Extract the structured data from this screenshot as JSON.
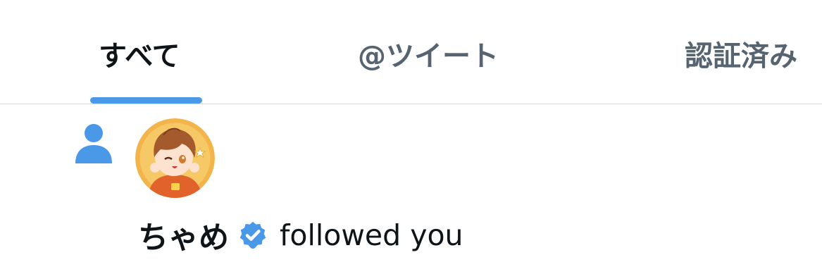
{
  "tabs": [
    {
      "label": "すべて",
      "selected": true
    },
    {
      "label": "@ツイート",
      "selected": false
    },
    {
      "label": "認証済み",
      "selected": false
    }
  ],
  "notification": {
    "type_icon": "person-icon",
    "user_name": "ちゃめ",
    "verified": true,
    "action_text": "followed you"
  },
  "colors": {
    "accent": "#4a98e8",
    "inactive_tab": "#566370",
    "text": "#0f1419"
  }
}
